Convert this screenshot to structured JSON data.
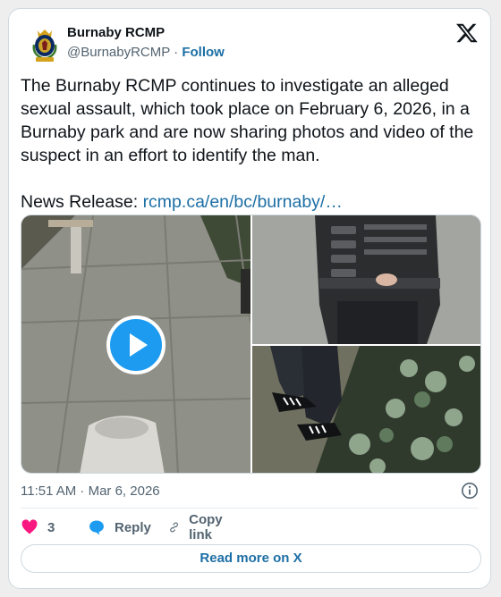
{
  "account": {
    "name": "Burnaby RCMP",
    "handle": "@BurnabyRCMP",
    "separator": "·",
    "follow_label": "Follow",
    "badge_text": "Burnaby"
  },
  "post": {
    "body": "The Burnaby RCMP continues to investigate an alleged sexual assault, which took place on February 6, 2026, in a Burnaby park and are now sharing photos and video of the suspect in an effort to identify the man.",
    "link_prefix": "News Release: ",
    "link_text": "rcmp.ca/en/bc/burnaby/…",
    "timestamp": "11:51 AM · Mar 6, 2026"
  },
  "media": {
    "items": [
      {
        "kind": "video",
        "icon": "play-icon"
      },
      {
        "kind": "photo"
      },
      {
        "kind": "photo"
      }
    ]
  },
  "actions": {
    "like_count": "3",
    "reply_label": "Reply",
    "copy_label": "Copy link",
    "read_more_label": "Read more on X"
  },
  "colors": {
    "link": "#1d6fa5",
    "like": "#f91880",
    "reply": "#1d9bf0",
    "text": "#0f1419",
    "muted": "#536471"
  },
  "icons": [
    "rcmp-crest-icon",
    "x-logo-icon",
    "play-icon",
    "info-icon",
    "heart-icon",
    "reply-bubble-icon",
    "link-icon"
  ]
}
